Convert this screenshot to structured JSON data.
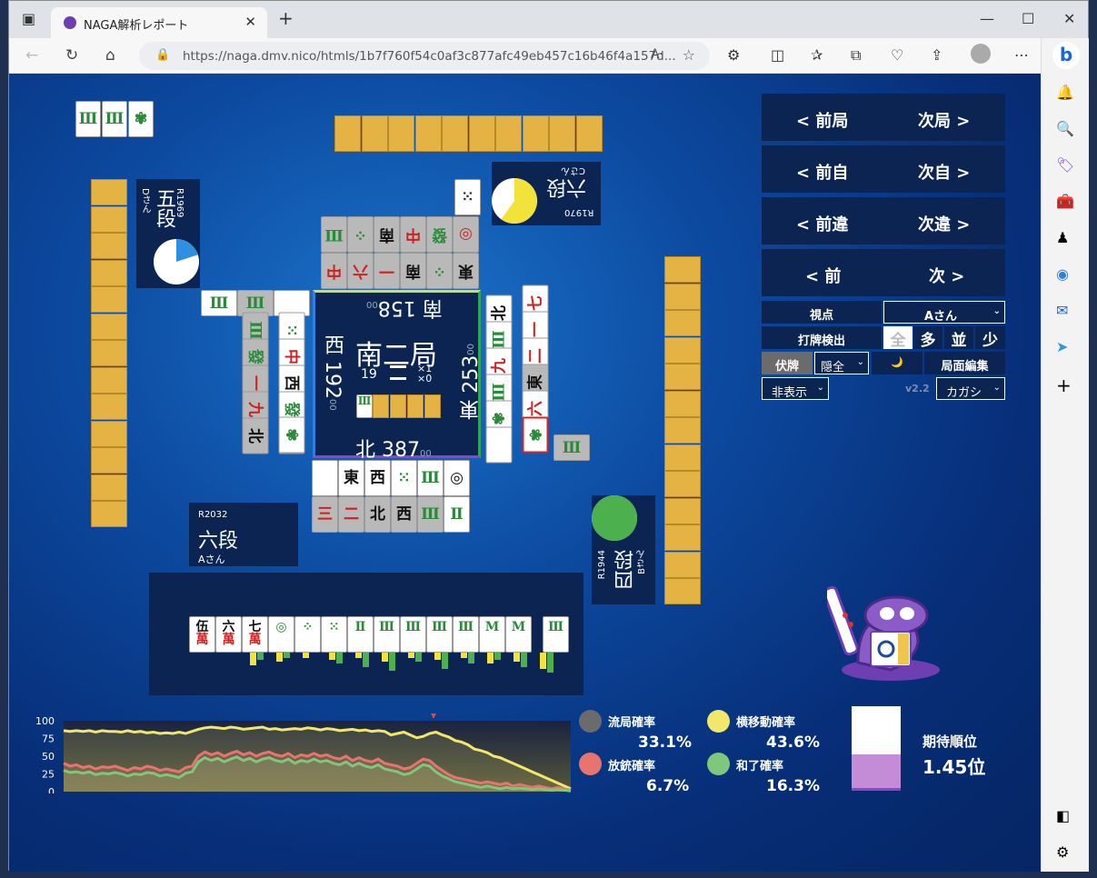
{
  "browser": {
    "tab_title": "NAGA解析レポート",
    "url": "https://naga.dmv.nico/htmls/1b7f760f54c0af3c877afc49eb457c16b46f4a157d..."
  },
  "nav": {
    "prev_round": "< 前局",
    "next_round": "次局 >",
    "prev_self": "< 前自",
    "next_self": "次自 >",
    "prev_diff": "< 前違",
    "next_diff": "次違 >",
    "prev": "< 前",
    "next": "次 >"
  },
  "controls": {
    "viewpoint_label": "視点",
    "viewpoint_value": "Aさん",
    "detect_label": "打牌検出",
    "detect_options": [
      "全",
      "多",
      "並",
      "少"
    ],
    "fuhai_label": "伏牌",
    "fuhai_value": "隠全",
    "moon": "🌙",
    "edit_label": "局面編集",
    "display_value": "非表示",
    "version": "v2.2",
    "char_value": "カガシ"
  },
  "center": {
    "round": "南二局",
    "south": "南 158",
    "west": "西 192",
    "east": "東 253",
    "north": "北 387",
    "score_suffix": "00",
    "remaining": "19",
    "honba": "×1",
    "riichi": "×0"
  },
  "players": {
    "top": {
      "rating": "R1970",
      "rank": "六段",
      "name": "Cさん",
      "pie": 0.6
    },
    "left": {
      "rating": "R1969",
      "rank": "五段",
      "name": "Dさん",
      "pie": 0.2
    },
    "self": {
      "rating": "R2032",
      "rank": "六段",
      "name": "Aさん"
    },
    "right": {
      "rating": "R1944",
      "rank": "四段",
      "name": "Bさん",
      "pie": 1
    }
  },
  "hand": [
    {
      "t": "伍",
      "s": "萬"
    },
    {
      "t": "六",
      "s": "萬"
    },
    {
      "t": "七",
      "s": "萬"
    },
    {
      "t": "◎"
    },
    {
      "t": "⁘"
    },
    {
      "t": "⁙"
    },
    {
      "t": "Ⅱ"
    },
    {
      "t": "Ⅲ"
    },
    {
      "t": "Ⅲ"
    },
    {
      "t": "Ⅲ"
    },
    {
      "t": "Ⅲ"
    },
    {
      "t": "M"
    },
    {
      "t": "M"
    },
    {
      "t": "Ⅲ"
    }
  ],
  "stats": {
    "ryukyoku": {
      "label": "流局確率",
      "value": "33.1%",
      "color": "#6b6b6b"
    },
    "yoko": {
      "label": "横移動確率",
      "value": "43.6%",
      "color": "#f2e66b"
    },
    "houju": {
      "label": "放銃確率",
      "value": "6.7%",
      "color": "#e8746f"
    },
    "agari": {
      "label": "和了確率",
      "value": "16.3%",
      "color": "#7fc77a"
    },
    "expect_label": "期待順位",
    "expect_value": "1.45位",
    "expect_fill": 0.43
  },
  "chart_data": {
    "type": "area",
    "yticks": [
      "100",
      "75",
      "50",
      "25",
      "0"
    ],
    "ylim": [
      0,
      100
    ],
    "series": [
      {
        "color": "#f2e66b",
        "values": [
          86,
          85,
          86,
          85,
          86,
          84,
          86,
          85,
          85,
          84,
          86,
          84,
          85,
          83,
          84,
          82,
          83,
          82,
          84,
          82,
          85,
          88,
          90,
          91,
          90,
          89,
          91,
          90,
          88,
          89,
          90,
          91,
          88,
          89,
          87,
          88,
          89,
          88,
          90,
          89,
          87,
          89,
          88,
          86,
          87,
          88,
          86,
          87,
          85,
          86,
          85,
          80,
          82,
          84,
          80,
          76,
          78,
          82,
          84,
          80,
          77,
          72,
          70,
          66,
          60,
          58,
          55,
          50,
          48,
          44,
          40,
          36,
          32,
          28,
          24,
          20,
          16,
          12,
          8,
          4
        ]
      },
      {
        "color": "#e8746f",
        "values": [
          40,
          36,
          38,
          34,
          36,
          32,
          35,
          34,
          36,
          33,
          30,
          34,
          32,
          36,
          34,
          30,
          32,
          30,
          28,
          34,
          36,
          50,
          56,
          52,
          55,
          50,
          54,
          57,
          52,
          55,
          50,
          54,
          56,
          52,
          50,
          54,
          48,
          52,
          50,
          54,
          50,
          52,
          48,
          46,
          50,
          44,
          48,
          44,
          42,
          46,
          40,
          38,
          36,
          32,
          34,
          40,
          46,
          44,
          36,
          30,
          24,
          20,
          18,
          16,
          14,
          12,
          14,
          12,
          10,
          12,
          8,
          10,
          8,
          6,
          8,
          6,
          4,
          6,
          4,
          2
        ]
      },
      {
        "color": "#7fc77a",
        "values": [
          30,
          27,
          28,
          26,
          28,
          24,
          26,
          25,
          27,
          25,
          22,
          25,
          24,
          27,
          26,
          22,
          24,
          22,
          20,
          26,
          28,
          42,
          48,
          44,
          47,
          42,
          46,
          49,
          44,
          47,
          42,
          46,
          48,
          44,
          42,
          46,
          40,
          44,
          42,
          46,
          42,
          44,
          40,
          38,
          42,
          36,
          40,
          36,
          34,
          38,
          32,
          30,
          28,
          24,
          26,
          32,
          38,
          36,
          28,
          22,
          18,
          14,
          12,
          10,
          8,
          6,
          8,
          6,
          4,
          6,
          4,
          5,
          4,
          3,
          4,
          3,
          2,
          3,
          2,
          1
        ]
      }
    ]
  }
}
